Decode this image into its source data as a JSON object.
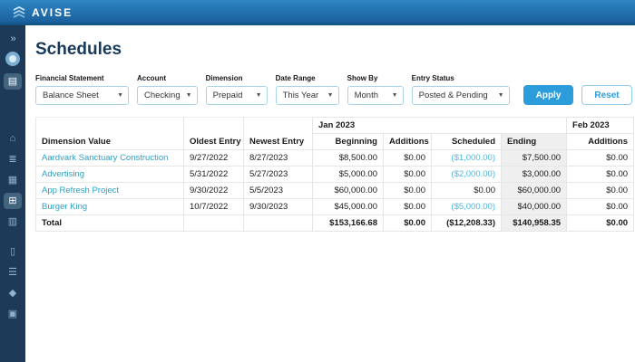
{
  "brand": {
    "name": "AVISE"
  },
  "page": {
    "title": "Schedules"
  },
  "sidebar": {
    "expand_glyph": "»",
    "icons": {
      "documents": "▤",
      "bank": "⌂",
      "ledger": "≣",
      "card": "▦",
      "schedules": "⊞",
      "reports": "▥",
      "phone": "▯",
      "receipt": "☰",
      "lock": "◆",
      "briefcase": "▣"
    }
  },
  "filters": {
    "financial_statement": {
      "label": "Financial Statement",
      "value": "Balance Sheet"
    },
    "account": {
      "label": "Account",
      "value": "Checking"
    },
    "dimension": {
      "label": "Dimension",
      "value": "Prepaid"
    },
    "date_range": {
      "label": "Date Range",
      "value": "This Year"
    },
    "show_by": {
      "label": "Show By",
      "value": "Month"
    },
    "entry_status": {
      "label": "Entry Status",
      "value": "Posted & Pending"
    }
  },
  "buttons": {
    "apply": "Apply",
    "reset": "Reset"
  },
  "table": {
    "months": {
      "jan": "Jan 2023",
      "feb": "Feb 2023"
    },
    "headers": {
      "dimension": "Dimension Value",
      "oldest": "Oldest Entry",
      "newest": "Newest Entry",
      "beginning": "Beginning",
      "additions": "Additions",
      "scheduled": "Scheduled",
      "ending": "Ending",
      "feb_additions": "Additions"
    },
    "rows": [
      {
        "name": "Aardvark Sanctuary Construction",
        "oldest": "9/27/2022",
        "newest": "8/27/2023",
        "beginning": "$8,500.00",
        "additions": "$0.00",
        "scheduled": "($1,000.00)",
        "ending": "$7,500.00",
        "feb_additions": "$0.00"
      },
      {
        "name": "Advertising",
        "oldest": "5/31/2022",
        "newest": "5/27/2023",
        "beginning": "$5,000.00",
        "additions": "$0.00",
        "scheduled": "($2,000.00)",
        "ending": "$3,000.00",
        "feb_additions": "$0.00"
      },
      {
        "name": "App Refresh Project",
        "oldest": "9/30/2022",
        "newest": "5/5/2023",
        "beginning": "$60,000.00",
        "additions": "$0.00",
        "scheduled": "$0.00",
        "ending": "$60,000.00",
        "feb_additions": "$0.00"
      },
      {
        "name": "Burger King",
        "oldest": "10/7/2022",
        "newest": "9/30/2023",
        "beginning": "$45,000.00",
        "additions": "$0.00",
        "scheduled": "($5,000.00)",
        "ending": "$40,000.00",
        "feb_additions": "$0.00"
      }
    ],
    "total": {
      "label": "Total",
      "beginning": "$153,166.68",
      "additions": "$0.00",
      "scheduled": "($12,208.33)",
      "ending": "$140,958.35",
      "feb_additions": "$0.00"
    }
  },
  "colors": {
    "accent": "#2d9cdb",
    "link": "#2f9fc1",
    "negative_blue": "#4cb8dc",
    "sidebar": "#1d3b58"
  }
}
